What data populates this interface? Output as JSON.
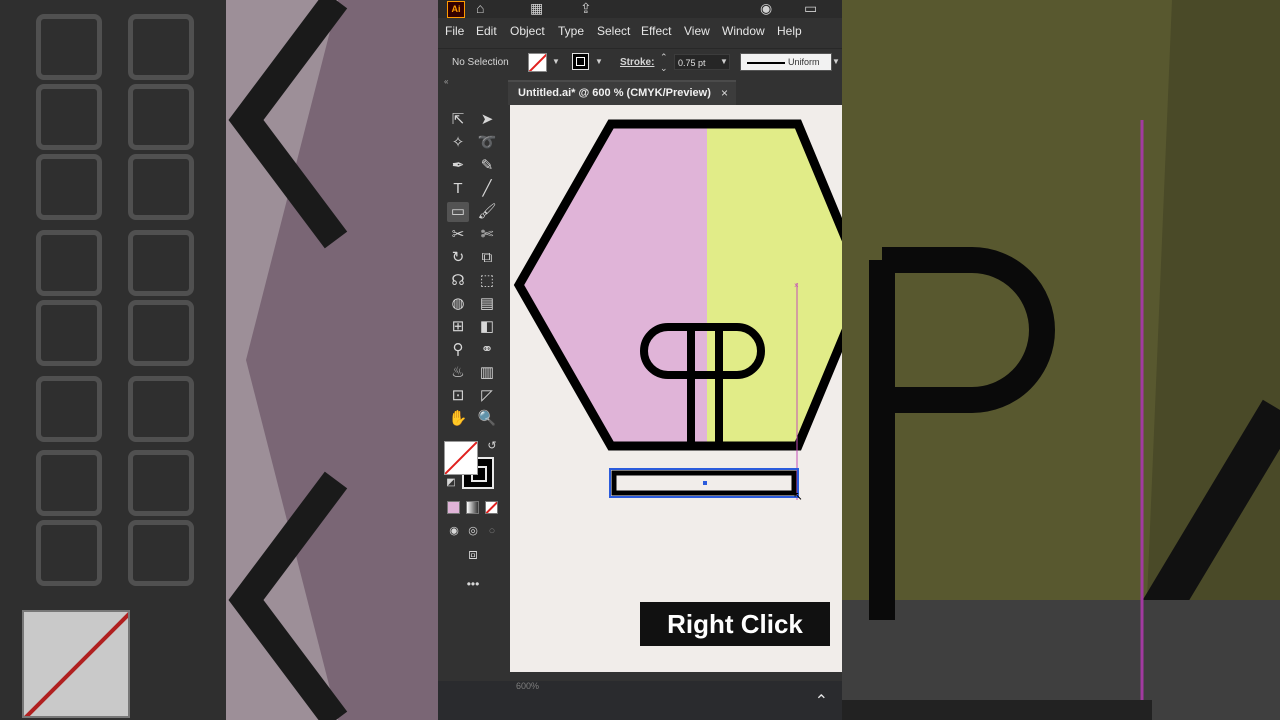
{
  "app": {
    "logo": "Ai",
    "titlebar_icons": [
      "home-icon",
      "workspace-grid-icon",
      "share-icon",
      "user-search-icon",
      "window-icon"
    ]
  },
  "menu": [
    "File",
    "Edit",
    "Object",
    "Type",
    "Select",
    "Effect",
    "View",
    "Window",
    "Help"
  ],
  "control_bar": {
    "selection_label": "No Selection",
    "stroke_label": "Stroke:",
    "stroke_value": "0.75 pt",
    "profile_label": "Uniform"
  },
  "document": {
    "tab_title": "Untitled.ai* @ 600 % (CMYK/Preview)",
    "close_glyph": "×"
  },
  "colors": {
    "pink": "#e0b4d8",
    "lime": "#e1ec88",
    "artboard": "#f1edea",
    "guide": "#c44fb8",
    "selection": "#2b5bdc"
  },
  "overlay": {
    "caption": "Right Click"
  },
  "status": {
    "zoom": "600%"
  }
}
